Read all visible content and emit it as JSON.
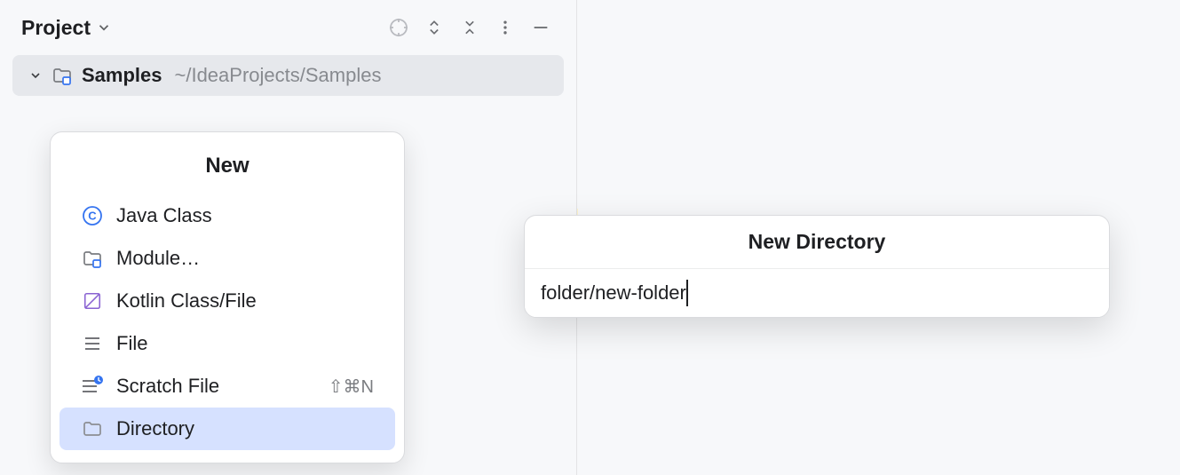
{
  "panel": {
    "title": "Project",
    "tree_item": {
      "name": "Samples",
      "path": "~/IdeaProjects/Samples"
    }
  },
  "new_menu": {
    "title": "New",
    "items": [
      {
        "icon": "java",
        "label": "Java Class",
        "shortcut": "",
        "selected": false
      },
      {
        "icon": "module",
        "label": "Module…",
        "shortcut": "",
        "selected": false
      },
      {
        "icon": "kotlin",
        "label": "Kotlin Class/File",
        "shortcut": "",
        "selected": false
      },
      {
        "icon": "file",
        "label": "File",
        "shortcut": "",
        "selected": false
      },
      {
        "icon": "scratch",
        "label": "Scratch File",
        "shortcut": "⇧⌘N",
        "selected": false
      },
      {
        "icon": "folder",
        "label": "Directory",
        "shortcut": "",
        "selected": true
      }
    ]
  },
  "dialog": {
    "title": "New Directory",
    "value": "folder/new-folder"
  }
}
